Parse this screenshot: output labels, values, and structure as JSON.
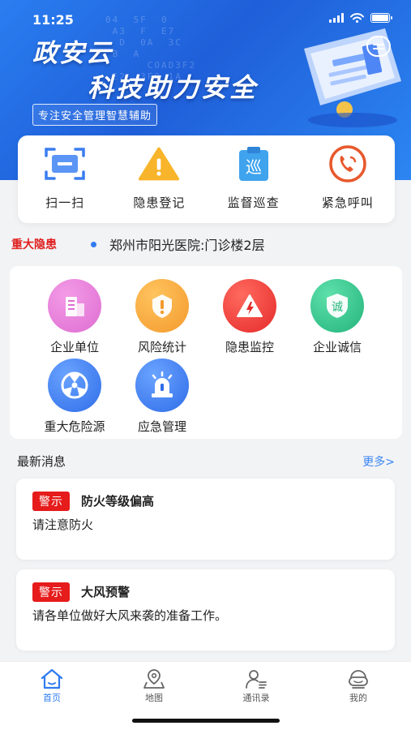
{
  "status": {
    "time": "11:25"
  },
  "banner": {
    "title_line1": "政安云",
    "title_line2": "科技助力安全",
    "subtitle": "专注安全管理智慧辅助",
    "digits": "04  5F  0\n A3  F  E7\n  D  0A  3C\n B  A\n      COAD3F2\n E2  3F9 1A"
  },
  "quick_actions": [
    {
      "label": "扫一扫",
      "icon": "scan-icon"
    },
    {
      "label": "隐患登记",
      "icon": "warning-triangle-icon"
    },
    {
      "label": "监督巡查",
      "icon": "patrol-clipboard-icon",
      "glyph": "巡"
    },
    {
      "label": "紧急呼叫",
      "icon": "phone-call-icon"
    }
  ],
  "notice": {
    "tag": "重大隐患",
    "text": "郑州市阳光医院:门诊楼2层"
  },
  "modules": [
    {
      "label": "企业单位",
      "icon": "building-icon",
      "color": "#e879d6"
    },
    {
      "label": "风险统计",
      "icon": "alert-badge-icon",
      "color": "#f6a43a"
    },
    {
      "label": "隐患监控",
      "icon": "lightning-warning-icon",
      "color": "#ef3434"
    },
    {
      "label": "企业诚信",
      "icon": "shield-icon",
      "color": "#2cbf86",
      "glyph": "诚"
    },
    {
      "label": "重大危险源",
      "icon": "radiation-icon",
      "color": "#3c7ff0"
    },
    {
      "label": "应急管理",
      "icon": "siren-icon",
      "color": "#3c7ff0"
    }
  ],
  "news": {
    "title": "最新消息",
    "more": "更多>",
    "items": [
      {
        "tag": "警示",
        "title": "防火等级偏高",
        "body": "请注意防火"
      },
      {
        "tag": "警示",
        "title": "大风预警",
        "body": "请各单位做好大风来袭的准备工作。"
      }
    ]
  },
  "tabs": [
    {
      "label": "首页",
      "icon": "home-icon",
      "active": true
    },
    {
      "label": "地图",
      "icon": "map-pin-icon",
      "active": false
    },
    {
      "label": "通讯录",
      "icon": "contacts-icon",
      "active": false
    },
    {
      "label": "我的",
      "icon": "profile-icon",
      "active": false
    }
  ]
}
